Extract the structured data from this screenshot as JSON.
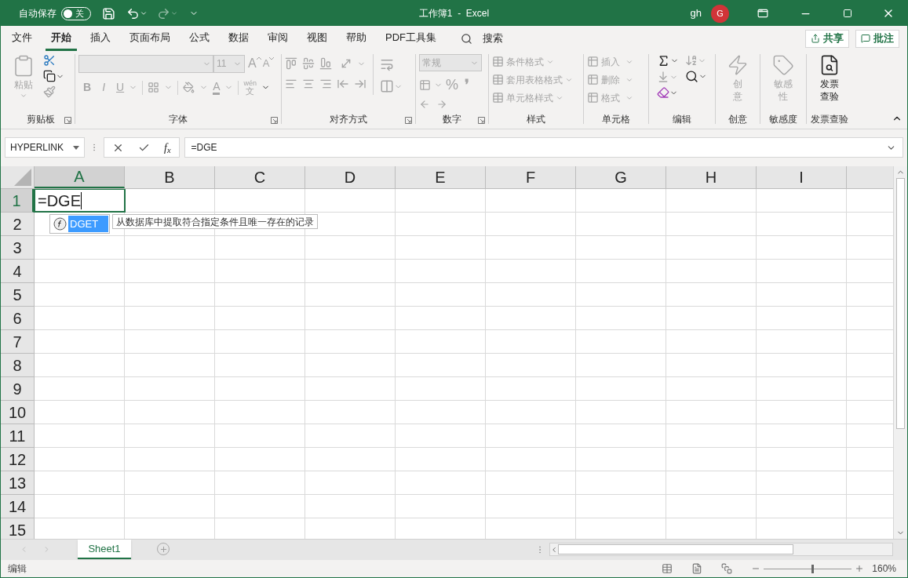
{
  "title_bar": {
    "autosave_label": "自动保存",
    "autosave_toggle": {
      "text": "关",
      "on": false
    },
    "title": "工作簿1  -  Excel",
    "user": "gh",
    "avatar": "G"
  },
  "menu_tabs": [
    {
      "label": "文件",
      "selected": false
    },
    {
      "label": "开始",
      "selected": true
    },
    {
      "label": "插入",
      "selected": false
    },
    {
      "label": "页面布局",
      "selected": false
    },
    {
      "label": "公式",
      "selected": false
    },
    {
      "label": "数据",
      "selected": false
    },
    {
      "label": "审阅",
      "selected": false
    },
    {
      "label": "视图",
      "selected": false
    },
    {
      "label": "帮助",
      "selected": false
    },
    {
      "label": "PDF工具集",
      "selected": false
    }
  ],
  "search": "搜索",
  "share_button": "共享",
  "comments_button": "批注",
  "ribbon": {
    "clipboard": {
      "label": "剪贴板",
      "paste": {
        "label": "粘贴",
        "disabled": true
      },
      "format_painter_disabled": true
    },
    "font": {
      "label": "字体",
      "disabled": true,
      "font_size": "11",
      "grow": "A",
      "shrink": "A",
      "bold": "B",
      "italic": "I",
      "underline": "U",
      "font_color": "A",
      "phonetic_top": "wén",
      "phonetic_bottom": "文"
    },
    "alignment": {
      "label": "对齐方式",
      "disabled": true
    },
    "number": {
      "label": "数字",
      "disabled": true,
      "format": "常规",
      "percent": "%",
      "comma": "❜"
    },
    "styles": {
      "label": "样式",
      "items": [
        {
          "label": "条件格式",
          "disabled": true
        },
        {
          "label": "套用表格格式",
          "disabled": true
        },
        {
          "label": "单元格样式",
          "disabled": true
        }
      ]
    },
    "cells": {
      "label": "单元格",
      "items": [
        {
          "label": "插入",
          "disabled": true
        },
        {
          "label": "删除",
          "disabled": true
        },
        {
          "label": "格式",
          "disabled": true
        }
      ]
    },
    "editing": {
      "label": "编辑"
    },
    "ideas": {
      "label": "创意",
      "button": {
        "label": "创意",
        "disabled": true
      }
    },
    "sensitivity": {
      "label": "敏感度",
      "button": {
        "label": "敏感性",
        "disabled": true
      }
    },
    "invoice": {
      "label": "发票查验",
      "button": {
        "label": "发票查验",
        "disabled": false
      }
    }
  },
  "formula_bar": {
    "name_box": "HYPERLINK",
    "fx": "f$_{x}$",
    "formula": "=DGE"
  },
  "grid": {
    "columns": [
      {
        "label": "A",
        "selected": true
      },
      {
        "label": "B",
        "selected": false
      },
      {
        "label": "C",
        "selected": false
      },
      {
        "label": "D",
        "selected": false
      },
      {
        "label": "E",
        "selected": false
      },
      {
        "label": "F",
        "selected": false
      },
      {
        "label": "G",
        "selected": false
      },
      {
        "label": "H",
        "selected": false
      },
      {
        "label": "I",
        "selected": false
      }
    ],
    "rows": [
      {
        "label": "1",
        "selected": true
      },
      {
        "label": "2",
        "selected": false
      },
      {
        "label": "3",
        "selected": false
      },
      {
        "label": "4",
        "selected": false
      },
      {
        "label": "5",
        "selected": false
      },
      {
        "label": "6",
        "selected": false
      },
      {
        "label": "7",
        "selected": false
      },
      {
        "label": "8",
        "selected": false
      },
      {
        "label": "9",
        "selected": false
      },
      {
        "label": "10",
        "selected": false
      },
      {
        "label": "11",
        "selected": false
      },
      {
        "label": "12",
        "selected": false
      },
      {
        "label": "13",
        "selected": false
      },
      {
        "label": "14",
        "selected": false
      },
      {
        "label": "15",
        "selected": false
      }
    ],
    "active_cell": "=DGE",
    "autocomplete": {
      "items": [
        {
          "label": "DGET",
          "selected": true
        }
      ],
      "tooltip": "从数据库中提取符合指定条件且唯一存在的记录"
    }
  },
  "sheet_tabs": [
    {
      "label": "Sheet1",
      "selected": true
    }
  ],
  "status_bar": {
    "mode": "编辑",
    "zoom": "160%",
    "zoom_slider": {
      "level": 0.54
    }
  }
}
